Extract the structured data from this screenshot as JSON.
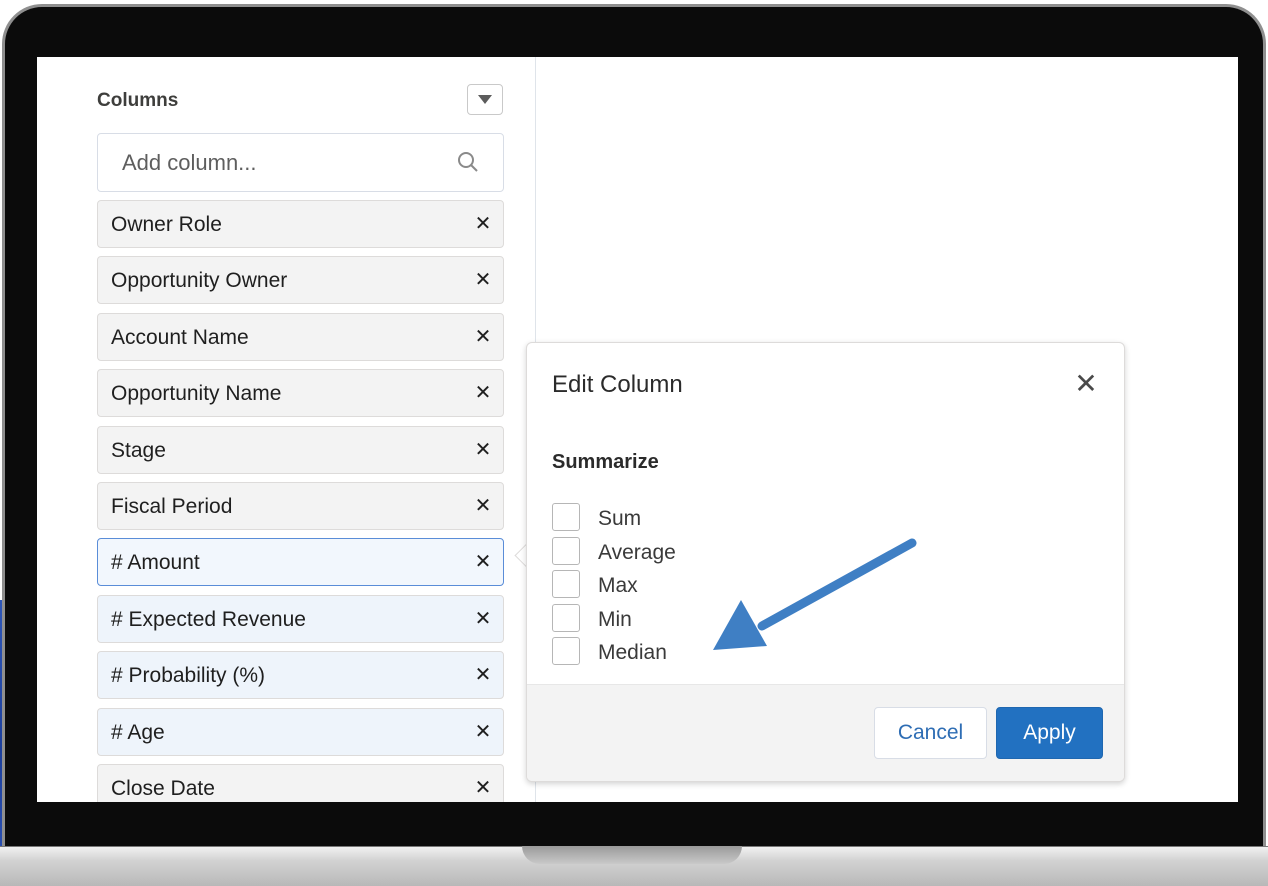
{
  "columns_panel": {
    "title": "Columns",
    "collapse_icon": "chevron-down-icon",
    "search": {
      "placeholder": "Add column...",
      "value": "",
      "icon": "search-icon"
    },
    "items": [
      {
        "label": "Owner Role",
        "numeric": false,
        "selected": false
      },
      {
        "label": "Opportunity Owner",
        "numeric": false,
        "selected": false
      },
      {
        "label": "Account Name",
        "numeric": false,
        "selected": false
      },
      {
        "label": "Opportunity Name",
        "numeric": false,
        "selected": false
      },
      {
        "label": "Stage",
        "numeric": false,
        "selected": false
      },
      {
        "label": "Fiscal Period",
        "numeric": false,
        "selected": false
      },
      {
        "label": "# Amount",
        "numeric": true,
        "selected": true
      },
      {
        "label": "# Expected Revenue",
        "numeric": true,
        "selected": false
      },
      {
        "label": "# Probability (%)",
        "numeric": true,
        "selected": false
      },
      {
        "label": "# Age",
        "numeric": true,
        "selected": false
      },
      {
        "label": "Close Date",
        "numeric": false,
        "selected": false
      }
    ],
    "remove_glyph": "✕"
  },
  "edit_column": {
    "title": "Edit Column",
    "close_glyph": "✕",
    "summarize_label": "Summarize",
    "options": [
      {
        "label": "Sum",
        "checked": false
      },
      {
        "label": "Average",
        "checked": false
      },
      {
        "label": "Max",
        "checked": false
      },
      {
        "label": "Min",
        "checked": false
      },
      {
        "label": "Median",
        "checked": false
      }
    ],
    "cancel_label": "Cancel",
    "apply_label": "Apply"
  },
  "annotation": {
    "icon": "arrow-pointer-icon",
    "color": "#4a86c8"
  },
  "colors": {
    "accent": "#2271c1",
    "selected_border": "#5a8dd8",
    "numeric_bg": "#eef4fb"
  }
}
